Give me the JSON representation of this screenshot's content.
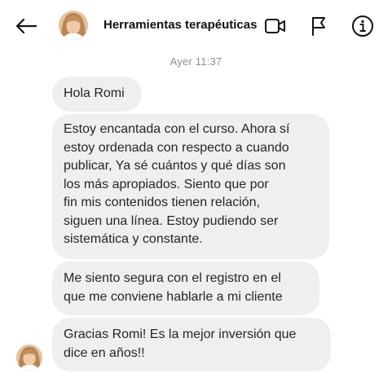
{
  "header": {
    "title": "Herramientas terapéuticas",
    "back_icon": "arrow-left-icon",
    "video_icon": "video-camera-icon",
    "flag_icon": "flag-icon",
    "info_icon": "info-icon"
  },
  "chat": {
    "timestamp": "Ayer 11:37",
    "messages": [
      {
        "text": "Hola Romi"
      },
      {
        "text": "Estoy encantada con el curso. Ahora sí\nestoy ordenada con respecto a cuando\npublicar, Ya sé cuántos y qué días son\nlos más apropiados. Siento que por\nfin mis contenidos tienen relación,\nsiguen una línea. Estoy pudiendo ser\nsistemática y constante."
      },
      {
        "text": "Me siento segura con el registro en el\nque me conviene hablarle a mi cliente"
      },
      {
        "text": "Gracias Romi! Es la mejor inversión que\ndice en años!!"
      }
    ]
  },
  "colors": {
    "bubble": "#efefef",
    "text": "#262626",
    "timestamp": "#8e8e8e"
  }
}
